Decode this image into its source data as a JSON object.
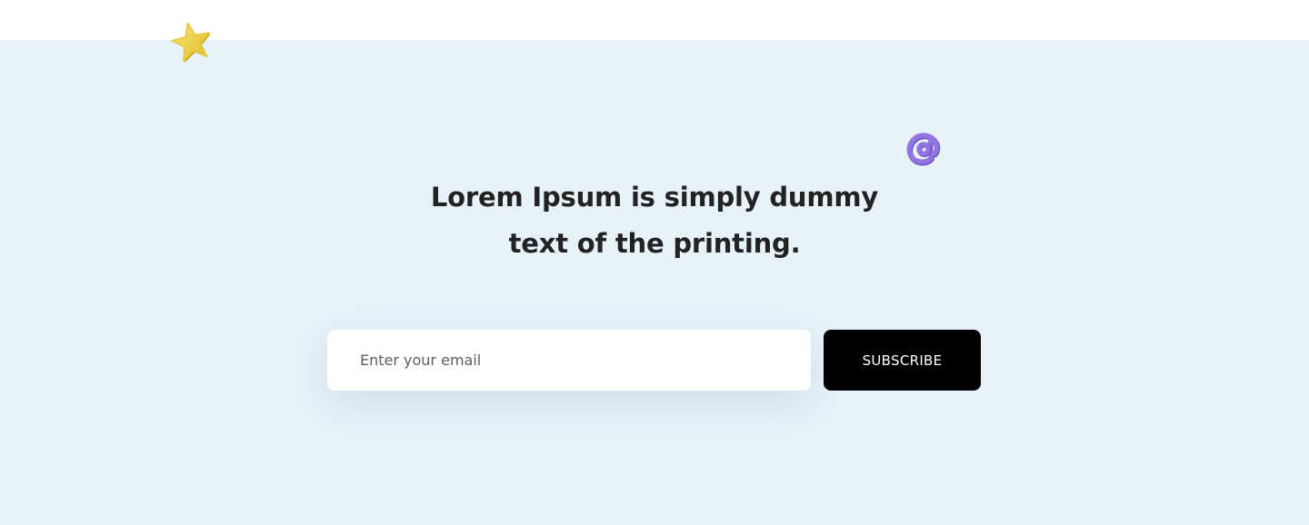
{
  "newsletter": {
    "headline_line1": "Lorem Ipsum is simply dummy",
    "headline_line2": "text of the printing.",
    "email_placeholder": "Enter your email",
    "email_value": "",
    "subscribe_label": "SUBSCRIBE"
  },
  "decorations": {
    "star_icon": "star-icon",
    "at_icon": "at-sign-icon"
  },
  "colors": {
    "section_background": "#e8f2f9",
    "heading_text": "#222222",
    "button_background": "#000000",
    "button_text": "#ffffff",
    "star_fill": "#f0d44f",
    "at_sign_fill": "#8d6fe0"
  }
}
